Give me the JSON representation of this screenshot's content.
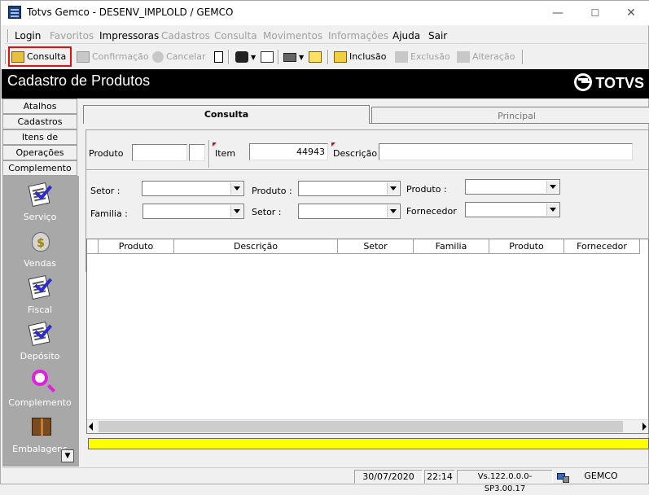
{
  "window": {
    "title": "Totvs Gemco - DESENV_IMPLOLD / GEMCO",
    "controls": {
      "minimize": "—",
      "maximize": "☐",
      "close": "✕"
    }
  },
  "menu": {
    "items": [
      "Login",
      "Favoritos",
      "Impressoras",
      "Cadastros",
      "Consulta",
      "Movimentos",
      "Informações",
      "Ajuda",
      "Sair"
    ],
    "disabled": [
      false,
      true,
      false,
      true,
      true,
      true,
      true,
      false,
      false
    ]
  },
  "toolbar": {
    "consulta": "Consulta",
    "confirmacao": "Confirmação",
    "cancelar": "Cancelar",
    "inclusao": "Inclusão",
    "exclusao": "Exclusão",
    "alteracao": "Alteração"
  },
  "header": {
    "title": "Cadastro de Produtos",
    "brand": "TOTVS"
  },
  "sidebar": {
    "buttons": [
      "Atalhos",
      "Cadastros",
      "Itens de Produto",
      "Operações",
      "Complemento"
    ],
    "items": [
      {
        "label": "Serviço",
        "icon": "document-check-icon"
      },
      {
        "label": "Vendas",
        "icon": "money-bag-icon"
      },
      {
        "label": "Fiscal",
        "icon": "document-check-icon"
      },
      {
        "label": "Depósito",
        "icon": "document-check-icon"
      },
      {
        "label": "Complemento",
        "icon": "magnifier-icon"
      },
      {
        "label": "Embalagens",
        "icon": "package-icon"
      }
    ]
  },
  "tabs": {
    "consulta": "Consulta",
    "principal": "Principal"
  },
  "form": {
    "produto_label": "Produto",
    "produto_value": "",
    "item_label": "Item",
    "item_value": "44943",
    "descricao_label": "Descrição",
    "descricao_value": "",
    "filters": {
      "setor1": "Setor :",
      "produto1": "Produto :",
      "produto2": "Produto :",
      "familia": "Familia :",
      "setor2": "Setor :",
      "fornecedor": "Fornecedor"
    }
  },
  "grid": {
    "columns": [
      "",
      "Produto",
      "Descrição",
      "Setor",
      "Familia",
      "Produto",
      "Fornecedor"
    ]
  },
  "status": {
    "date": "30/07/2020",
    "time": "22:14",
    "version": "Vs.122.0.0.0-SP3.00.17",
    "company": "GEMCO"
  },
  "colors": {
    "header_bg": "#000000",
    "sidebar_bg": "#a8a8a8",
    "highlight": "#e01010",
    "status_bar": "#ffff00"
  }
}
